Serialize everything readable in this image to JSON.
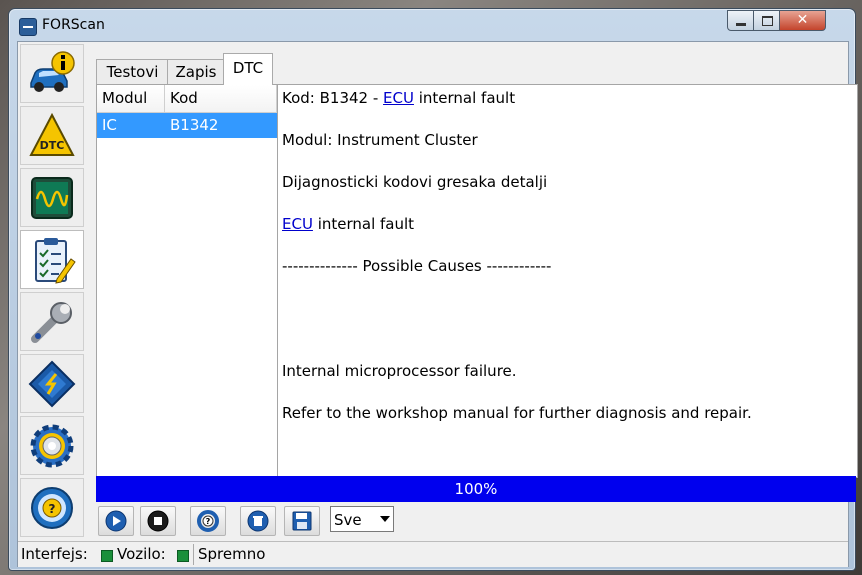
{
  "window": {
    "title": "FORScan",
    "close_glyph": "✕"
  },
  "nav": [
    {
      "icon": "car-info-icon"
    },
    {
      "icon": "dtc-icon",
      "label": "DTC"
    },
    {
      "icon": "oscilloscope-icon"
    },
    {
      "icon": "checklist-icon",
      "active": true
    },
    {
      "icon": "wrench-icon"
    },
    {
      "icon": "chip-icon"
    },
    {
      "icon": "gear-icon"
    },
    {
      "icon": "help-wheel-icon",
      "label": "?"
    }
  ],
  "tabs": [
    {
      "label": "Testovi"
    },
    {
      "label": "Zapis"
    },
    {
      "label": "DTC",
      "active": true
    }
  ],
  "list": {
    "headers": [
      "Modul",
      "Kod"
    ],
    "rows": [
      {
        "modul": "IC",
        "kod": "B1342",
        "selected": true
      }
    ]
  },
  "detail": {
    "line1_prefix": "Kod: B1342 - ",
    "line1_link": "ECU",
    "line1_suffix": " internal fault",
    "line2": "Modul: Instrument Cluster",
    "line3": "Dijagnosticki kodovi gresaka detalji",
    "line4_link": "ECU",
    "line4_suffix": " internal fault",
    "line5": "-------------- Possible Causes ------------",
    "line6": "Internal microprocessor failure.",
    "line7": "Refer to the workshop manual for further diagnosis and repair."
  },
  "progress": {
    "text": "100%",
    "value": 1.0
  },
  "toolbar": {
    "buttons": [
      "play-icon",
      "stop-icon",
      "help-lifebuoy-icon",
      "delete-icon",
      "save-icon"
    ],
    "select_value": "Sve"
  },
  "status": {
    "interfejs_label": "Interfejs:",
    "vozilo_label": "Vozilo:",
    "state": "Spremno"
  },
  "colors": {
    "selection": "#3399ff",
    "progress": "#0000ee",
    "link": "#0000cc",
    "led": "#1a8f3a"
  }
}
